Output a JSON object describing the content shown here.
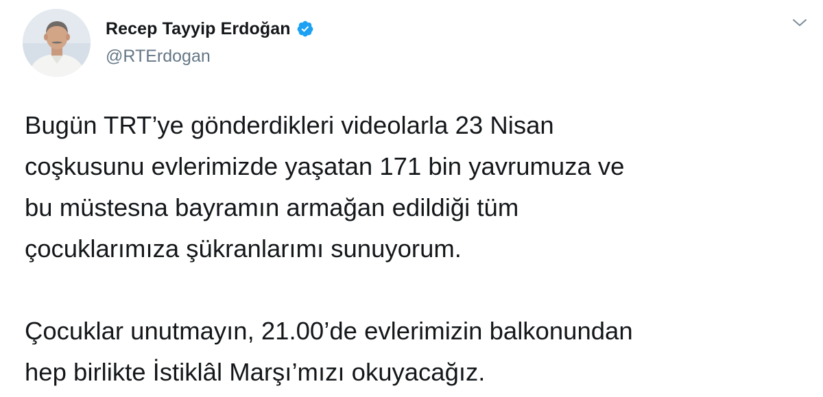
{
  "author": {
    "display_name": "Recep Tayyip Erdoğan",
    "handle": "@RTErdogan",
    "verified": true,
    "verified_icon": "verified-badge-icon",
    "verified_color": "#1da1f2"
  },
  "tweet": {
    "text": "Bugün TRT’ye gönderdikleri videolarla 23 Nisan\ncoşkusunu evlerimizde yaşatan 171 bin yavrumuza ve\nbu müstesna bayramın armağan edildiği tüm\nçocuklarımıza şükranlarımı sunuyorum.\n\nÇocuklar unutmayın, 21.00’de evlerimizin balkonundan\nhep birlikte İstiklâl Marşı’mızı okuyacağız."
  },
  "menu": {
    "icon": "chevron-down-icon"
  },
  "colors": {
    "name": "#14171a",
    "handle": "#657786",
    "body": "#14171a",
    "caret": "#657786"
  }
}
